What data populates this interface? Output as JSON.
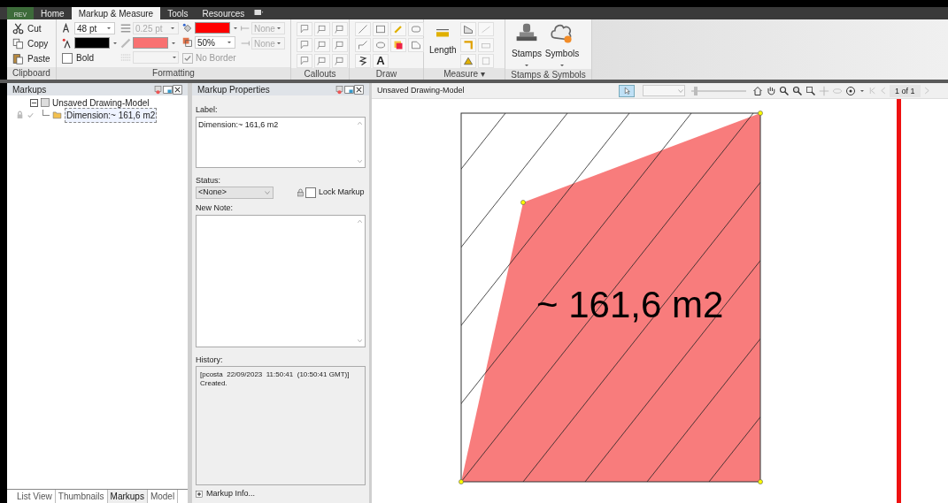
{
  "app_button": {
    "label": "REV"
  },
  "ribbon_tabs": [
    {
      "label": "Home",
      "selected": false
    },
    {
      "label": "Markup & Measure",
      "selected": true
    },
    {
      "label": "Tools",
      "selected": false
    },
    {
      "label": "Resources",
      "selected": false
    }
  ],
  "clipboard": {
    "buttons": [
      {
        "kind": "cut",
        "label": "Cut"
      },
      {
        "kind": "copy",
        "label": "Copy"
      },
      {
        "kind": "paste",
        "label": "Paste"
      }
    ],
    "group_label": "Clipboard"
  },
  "formatting": {
    "font_size": {
      "value": "48 pt",
      "disabled": false
    },
    "text_color": {
      "color": "#000000"
    },
    "bold": {
      "label": "Bold",
      "checked": false
    },
    "line_width": {
      "value": "0.25 pt",
      "disabled": true
    },
    "line_color": {
      "color": "#f87171"
    },
    "fill_color": {
      "color": "#ff0000"
    },
    "transparency": {
      "value": "50%",
      "disabled": false
    },
    "no_border": {
      "label": "No Border",
      "checked": true,
      "disabled": true
    },
    "arrow_start": {
      "value": "None",
      "disabled": true
    },
    "arrow_end": {
      "value": "None",
      "disabled": true
    },
    "group_label": "Formatting"
  },
  "callouts": {
    "group_label": "Callouts"
  },
  "draw": {
    "text_tool": "A",
    "group_label": "Draw"
  },
  "measure": {
    "length_label": "Length",
    "group_label": "Measure ▾"
  },
  "stamps": {
    "buttons": [
      {
        "kind": "stamp",
        "label": "Stamps"
      },
      {
        "kind": "symbol",
        "label": "Symbols"
      }
    ],
    "group_label": "Stamps & Symbols"
  },
  "markups_panel": {
    "title": "Markups",
    "tree": [
      {
        "label": "Unsaved Drawing-Model",
        "expanded": true,
        "selected": false,
        "children": [
          {
            "label": "Dimension:~ 161,6 m2",
            "selected": true
          }
        ]
      }
    ],
    "bottom_tabs": [
      {
        "label": "List View",
        "selected": false
      },
      {
        "label": "Thumbnails",
        "selected": false
      },
      {
        "label": "Markups",
        "selected": true
      },
      {
        "label": "Model",
        "selected": false
      }
    ]
  },
  "properties_panel": {
    "title": "Markup Properties",
    "label_caption": "Label:",
    "label_value": "Dimension:~ 161,6 m2",
    "status_caption": "Status:",
    "status_value": "<None>",
    "lock": {
      "label": "Lock Markup",
      "checked": false
    },
    "note_caption": "New Note:",
    "history_caption": "History:",
    "history": [
      "[pcosta  22/09/2023  11:50:41  (10:50:41 GMT)]",
      "Created."
    ],
    "info_label": "Markup Info..."
  },
  "viewer": {
    "title": "Unsaved Drawing-Model",
    "zoom_slider": {
      "level": 0.05
    },
    "page": "1 of 1",
    "area_label": "~ 161,6 m2"
  }
}
